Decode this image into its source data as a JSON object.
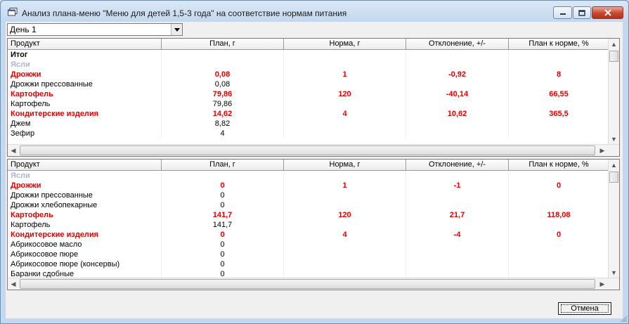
{
  "window": {
    "title": "Анализ плана-меню \"Меню для детей 1,5-3 года\" на соответствие нормам питания"
  },
  "day_select": {
    "value": "День 1"
  },
  "columns": [
    "Продукт",
    "План, г",
    "Норма, г",
    "Отклонение, +/-",
    "План к норме, %"
  ],
  "grid_top": {
    "rows": [
      {
        "type": "total",
        "cells": [
          "Итог",
          "",
          "",
          "",
          ""
        ]
      },
      {
        "type": "group",
        "cells": [
          "Ясли",
          "",
          "",
          "",
          ""
        ]
      },
      {
        "type": "cat",
        "cells": [
          "Дрожжи",
          "0,08",
          "1",
          "-0,92",
          "8"
        ]
      },
      {
        "type": "item",
        "cells": [
          "Дрожжи прессованные",
          "0,08",
          "",
          "",
          ""
        ]
      },
      {
        "type": "cat",
        "cells": [
          "Картофель",
          "79,86",
          "120",
          "-40,14",
          "66,55"
        ]
      },
      {
        "type": "item",
        "cells": [
          "Картофель",
          "79,86",
          "",
          "",
          ""
        ]
      },
      {
        "type": "cat",
        "cells": [
          "Кондитерские изделия",
          "14,62",
          "4",
          "10,62",
          "365,5"
        ]
      },
      {
        "type": "item",
        "cells": [
          "Джем",
          "8,82",
          "",
          "",
          ""
        ]
      },
      {
        "type": "item",
        "cells": [
          "Зефир",
          "4",
          "",
          "",
          ""
        ]
      }
    ]
  },
  "grid_bottom": {
    "rows": [
      {
        "type": "group",
        "cells": [
          "Ясли",
          "",
          "",
          "",
          ""
        ]
      },
      {
        "type": "cat",
        "cells": [
          "Дрожжи",
          "0",
          "1",
          "-1",
          "0"
        ]
      },
      {
        "type": "item",
        "cells": [
          "Дрожжи прессованные",
          "0",
          "",
          "",
          ""
        ]
      },
      {
        "type": "item",
        "cells": [
          "Дрожжи хлебопекарные",
          "0",
          "",
          "",
          ""
        ]
      },
      {
        "type": "cat",
        "cells": [
          "Картофель",
          "141,7",
          "120",
          "21,7",
          "118,08"
        ]
      },
      {
        "type": "item",
        "cells": [
          "Картофель",
          "141,7",
          "",
          "",
          ""
        ]
      },
      {
        "type": "cat",
        "cells": [
          "Кондитерские изделия",
          "0",
          "4",
          "-4",
          "0"
        ]
      },
      {
        "type": "item",
        "cells": [
          "Абрикосовое масло",
          "0",
          "",
          "",
          ""
        ]
      },
      {
        "type": "item",
        "cells": [
          "Абрикосовое пюре",
          "0",
          "",
          "",
          ""
        ]
      },
      {
        "type": "item",
        "cells": [
          "Абрикосовое пюре (консервы)",
          "0",
          "",
          "",
          ""
        ]
      },
      {
        "type": "item",
        "cells": [
          "Баранки сдобные",
          "0",
          "",
          "",
          ""
        ]
      }
    ]
  },
  "buttons": {
    "cancel": "Отмена"
  },
  "icons": {
    "app": "window-app-icon",
    "minimize": "minimize-icon",
    "maximize": "maximize-icon",
    "close": "close-icon",
    "dropdown": "chevron-down-icon"
  },
  "colors": {
    "category_text": "#e10000",
    "group_text": "#a6b9cf",
    "close_button": "#c8472e"
  }
}
